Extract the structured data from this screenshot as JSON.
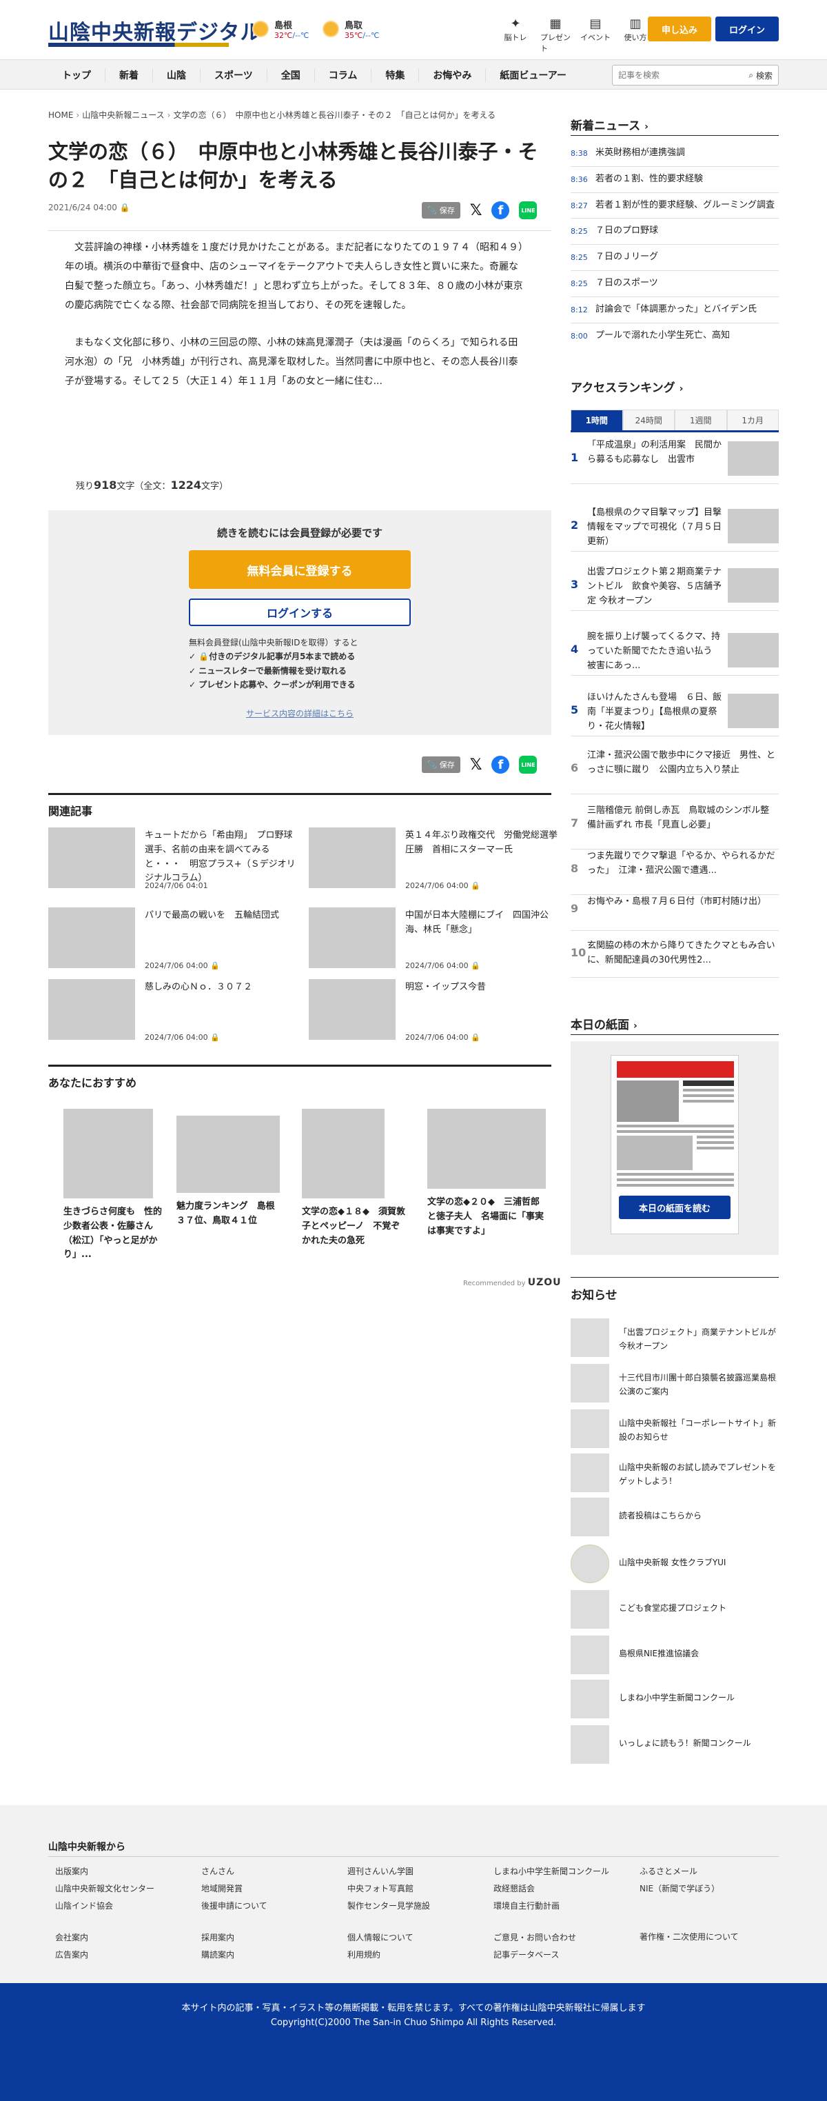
{
  "header": {
    "logo": "山陰中央新報デジタル",
    "weather": [
      {
        "city": "島根",
        "hi": "32℃",
        "lo": "/--℃"
      },
      {
        "city": "鳥取",
        "hi": "35℃",
        "lo": "/--℃"
      }
    ],
    "icons": [
      {
        "name": "brain-training-icon",
        "label": "脳トレ",
        "glyph": "✦"
      },
      {
        "name": "present-icon",
        "label": "プレゼント",
        "glyph": "▦"
      },
      {
        "name": "event-icon",
        "label": "イベント",
        "glyph": "▤"
      },
      {
        "name": "how-to-use-icon",
        "label": "使い方",
        "glyph": "▥"
      }
    ],
    "subscribe_label": "申し込み",
    "login_label": "ログイン"
  },
  "nav": {
    "items": [
      "トップ",
      "新着",
      "山陰",
      "スポーツ",
      "全国",
      "コラム",
      "特集",
      "お悔やみ",
      "紙面ビューアー"
    ],
    "search_placeholder": "記事を検索",
    "search_label": "検索"
  },
  "breadcrumb": [
    "HOME",
    "山陰中央新報ニュース",
    "文学の恋（６）　中原中也と小林秀雄と長谷川泰子・その２　「自己とは何か」を考える"
  ],
  "article": {
    "title": "文学の恋（６）　中原中也と小林秀雄と長谷川泰子・その２　「自己とは何か」を考える",
    "date": "2021/6/24 04:00",
    "save_label": "保存",
    "paragraphs": [
      "文芸評論の神様・小林秀雄を１度だけ見かけたことがある。まだ記者になりたての１９７４（昭和４９）年の頃。横浜の中華街で昼食中、店のシューマイをテークアウトで夫人らしき女性と買いに来た。奇麗な白髪で整った顔立ち。「あっ、小林秀雄だ！」と思わず立ち上がった。そして８３年、８０歳の小林が東京の慶応病院で亡くなる際、社会部で同病院を担当しており、その死を速報した。",
      "まもなく文化部に移り、小林の三回忌の際、小林の妹高見澤潤子（夫は漫画「のらくろ」で知られる田河水泡）の「兄　小林秀雄」が刊行され、高見澤を取材した。当然同書に中原中也と、その恋人長谷川泰子が登場する。そして２５（大正１４）年１１月「あの女と一緒に住む..."
    ],
    "remaining_prefix": "残り",
    "remaining_count": "918",
    "remaining_mid": "文字（全文：",
    "total_count": "1224",
    "remaining_suffix": "文字）"
  },
  "paywall": {
    "title": "続きを読むには会員登録が必要です",
    "register_label": "無料会員に登録する",
    "login_label": "ログインする",
    "benefits_intro": "無料会員登録(山陰中央新報IDを取得）すると",
    "benefits": [
      "付きのデジタル記事が月5本まで読める",
      "ニュースレターで最新情報を受け取れる",
      "プレゼント応募や、クーポンが利用できる"
    ],
    "details_link": "サービス内容の詳細はこちら"
  },
  "related": {
    "heading": "関連記事",
    "items": [
      {
        "title": "キュートだから「希由翔」　プロ野球選手、名前の由来を調べてみると・・・　明窓プラス+（Ｓデジオリジナルコラム）",
        "date": "2024/7/06 04:01",
        "locked": false
      },
      {
        "title": "英１４年ぶり政権交代　労働党総選挙圧勝　首相にスターマー氏",
        "date": "2024/7/06 04:00",
        "locked": true
      },
      {
        "title": "パリで最高の戦いを　五輪結団式",
        "date": "2024/7/06 04:00",
        "locked": true
      },
      {
        "title": "中国が日本大陸棚にブイ　四国沖公海、林氏「懸念」",
        "date": "2024/7/06 04:00",
        "locked": true
      },
      {
        "title": "慈しみの心Ｎｏ．３０７２",
        "date": "2024/7/06 04:00",
        "locked": true
      },
      {
        "title": "明窓・イップス今昔",
        "date": "2024/7/06 04:00",
        "locked": true
      }
    ]
  },
  "recommend": {
    "heading": "あなたにおすすめ",
    "items": [
      "生きづらさ何度も　性的少数者公表・佐藤さん（松江）「やっと足がかり」...",
      "魅力度ランキング　島根３７位、鳥取４１位",
      "文学の恋◆１８◆　須賀敦子とペッピーノ　不覚ぞかれた夫の急死",
      "文学の恋◆２０◆　三浦哲郎と徳子夫人　名場面に「事実は事実ですよ」"
    ],
    "recommended_by": "Recommended by",
    "brand": "UZOU"
  },
  "sidebar": {
    "news_heading": "新着ニュース",
    "news": [
      {
        "time": "8:38",
        "title": "米英財務相が連携強調"
      },
      {
        "time": "8:36",
        "title": "若者の１割、性的要求経験"
      },
      {
        "time": "8:27",
        "title": "若者１割が性的要求経験、グルーミング調査"
      },
      {
        "time": "8:25",
        "title": "７日のプロ野球"
      },
      {
        "time": "8:25",
        "title": "７日のＪリーグ"
      },
      {
        "time": "8:25",
        "title": "７日のスポーツ"
      },
      {
        "time": "8:12",
        "title": "討論会で「体調悪かった」とバイデン氏"
      },
      {
        "time": "8:00",
        "title": "プールで溺れた小学生死亡、高知"
      }
    ],
    "ranking_heading": "アクセスランキング",
    "ranking_tabs": [
      "1時間",
      "24時間",
      "1週間",
      "1カ月"
    ],
    "ranking": [
      {
        "n": "1",
        "title": "「平成温泉」の利活用案　民間から募るも応募なし　出雲市",
        "img": true
      },
      {
        "n": "2",
        "title": "【島根県のクマ目撃マップ】目撃情報をマップで可視化（７月５日更新）",
        "img": true
      },
      {
        "n": "3",
        "title": "出雲プロジェクト第２期商業テナントビル　飲食や美容、５店舗予定 今秋オープン",
        "img": true
      },
      {
        "n": "4",
        "title": "腕を振り上げ襲ってくるクマ、持っていた新聞でたたき追い払う　被害にあっ...",
        "img": true
      },
      {
        "n": "5",
        "title": "ほいけんたさんも登場　６日、飯南「半夏まつり」【島根県の夏祭り・花火情報】",
        "img": true
      },
      {
        "n": "6",
        "title": "江津・菰沢公園で散歩中にクマ接近　男性、とっさに顎に蹴り　公園内立ち入り禁止",
        "img": false
      },
      {
        "n": "7",
        "title": "三階稽億元 前倒し赤瓦　鳥取城のシンボル整備計画ずれ 市長「見直し必要」",
        "img": false
      },
      {
        "n": "8",
        "title": "つま先蹴りでクマ撃退「やるか、やられるかだった」　江津・菰沢公園で遭遇...",
        "img": false
      },
      {
        "n": "9",
        "title": "お悔やみ・島根７月６日付（市町村随け出）",
        "img": false
      },
      {
        "n": "10",
        "title": "玄関脇の柿の木から降りてきたクマともみ合いに、新聞配達員の30代男性2...",
        "img": false
      }
    ],
    "paper_heading": "本日の紙面",
    "paper_button": "本日の紙面を読む",
    "notice_heading": "お知らせ",
    "notices": [
      "「出雲プロジェクト」商業テナントビルが今秋オープン",
      "十三代目市川團十郎白猿襲名披露巡業島根公演のご案内",
      "山陰中央新報社「コーポレートサイト」新設のお知らせ",
      "山陰中央新報のお試し読みでプレゼントをゲットしよう！",
      "読者投稿はこちらから",
      "山陰中央新報 女性クラブYUI",
      "こども食堂応援プロジェクト",
      "島根県NIE推進協議会",
      "しまね小中学生新聞コンクール",
      "いっしょに読もう！新聞コンクール"
    ]
  },
  "footer": {
    "heading": "山陰中央新報から",
    "col1": [
      "出版案内",
      "地域開発センター",
      "山陰インド協会",
      "",
      "会社案内",
      "広告案内"
    ],
    "col2": [
      "さんさん",
      "地域開発賞",
      "後援申請について",
      "",
      "採用案内",
      "購読案内"
    ],
    "col3": [
      "週刊さんいん学園",
      "中央フォト写真館",
      "製作センター見学施設",
      "",
      "個人情報について",
      "利用規約"
    ],
    "col4": [
      "しまね小中学生新聞コンクール",
      "政経懇話会",
      "環境自主行動計画",
      "",
      "ご意見・お問い合わせ",
      "記事データベース"
    ],
    "col5": [
      "ふるさとメール",
      "NIE（新聞で学ぼう）",
      "",
      "",
      "著作権・二次使用について",
      ""
    ],
    "col1_extra": "山陰中央新報文化センター",
    "copy1": "本サイト内の記事・写真・イラスト等の無断掲載・転用を禁じます。すべての著作権は山陰中央新報社に帰属します",
    "copy2": "Copyright(C)2000 The San-in Chuo Shimpo All Rights Reserved."
  }
}
